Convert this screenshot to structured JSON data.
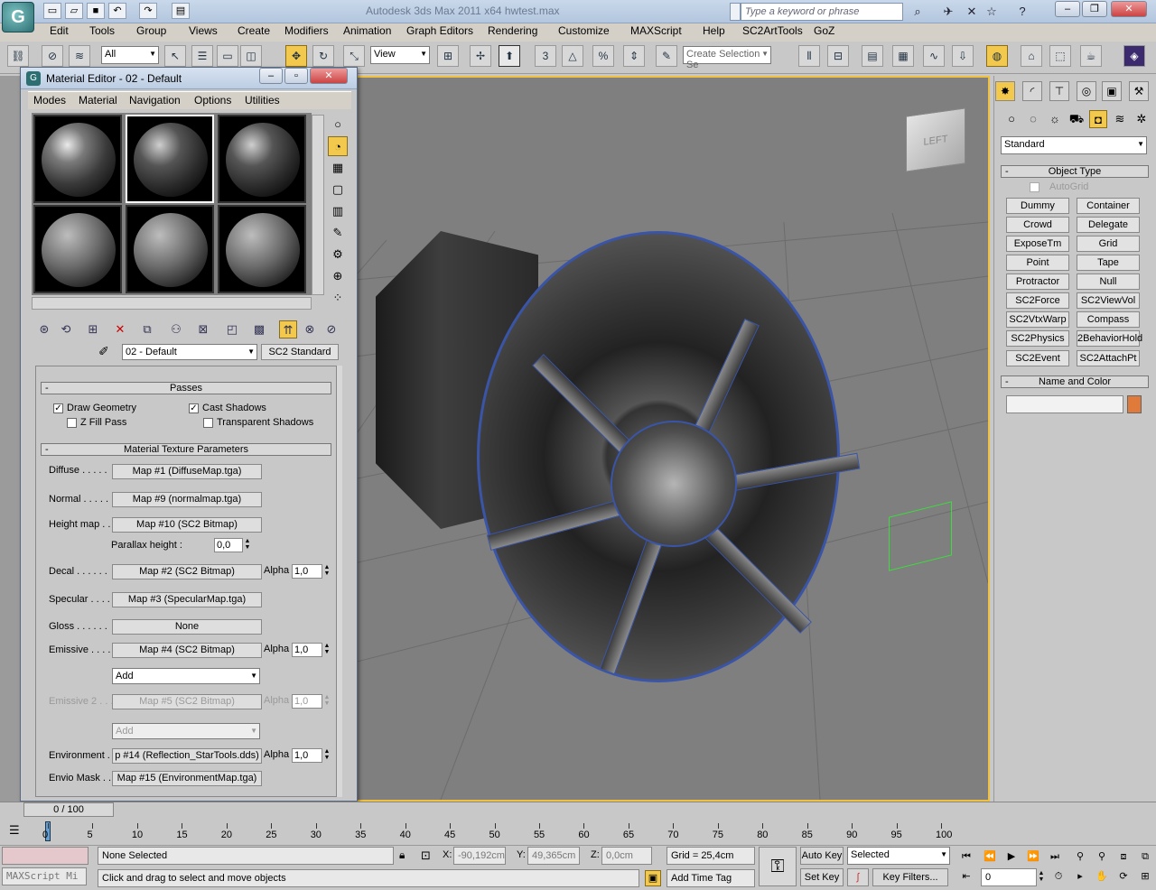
{
  "app": {
    "logo_label": "G",
    "title": "Autodesk 3ds Max  2011 x64      hwtest.max",
    "search_placeholder": "Type a keyword or phrase",
    "window_buttons": [
      "–",
      "❐",
      "✕"
    ]
  },
  "menubar": [
    "Edit",
    "Tools",
    "Group",
    "Views",
    "Create",
    "Modifiers",
    "Animation",
    "Graph Editors",
    "Rendering",
    "Customize",
    "MAXScript",
    "Help",
    "SC2ArtTools",
    "GoZ"
  ],
  "toolbar": {
    "selection_filter": "All",
    "ref_coord": "View",
    "selection_set_placeholder": "Create Selection Se",
    "snap_label": "3",
    "angle_snap_label": "△",
    "percent_snap_label": "%"
  },
  "material_editor": {
    "title": "Material Editor - 02 - Default",
    "menu": [
      "Modes",
      "Material",
      "Navigation",
      "Options",
      "Utilities"
    ],
    "material_name": "02 - Default",
    "material_type": "SC2 Standard",
    "passes": {
      "header": "Passes",
      "draw_geometry": "Draw Geometry",
      "cast_shadows": "Cast Shadows",
      "z_fill_pass": "Z Fill Pass",
      "transparent_shadows": "Transparent Shadows"
    },
    "params_header": "Material Texture Parameters",
    "maps": [
      {
        "label": "Diffuse . . . . .",
        "map": "Map #1 (DiffuseMap.tga)"
      },
      {
        "label": "Normal . . . . .",
        "map": "Map #9 (normalmap.tga)"
      },
      {
        "label": "Height map . .",
        "map": "Map #10 (SC2 Bitmap)"
      },
      {
        "label": "Decal . . . . . .",
        "map": "Map #2 (SC2 Bitmap)",
        "alpha": "1,0"
      },
      {
        "label": "Specular . . . .",
        "map": "Map #3 (SpecularMap.tga)"
      },
      {
        "label": "Gloss . . . . . .",
        "map": "None"
      },
      {
        "label": "Emissive . . . .",
        "map": "Map #4 (SC2 Bitmap)",
        "alpha": "1,0"
      },
      {
        "label": "Emissive 2 . . .",
        "map": "Map #5 (SC2 Bitmap)",
        "alpha": "1,0"
      },
      {
        "label": "Environment . .",
        "map": "p #14 (Reflection_StarTools.dds)",
        "alpha": "1,0"
      },
      {
        "label": "Envio Mask . .",
        "map": "Map #15 (EnvironmentMap.tga)"
      }
    ],
    "parallax_label": "Parallax height :",
    "parallax_value": "0,0",
    "alpha_label": "Alpha",
    "add_label": "Add"
  },
  "command_panel": {
    "category": "Standard",
    "object_type_header": "Object Type",
    "autogrid": "AutoGrid",
    "buttons": [
      "Dummy",
      "Container",
      "Crowd",
      "Delegate",
      "ExposeTm",
      "Grid",
      "Point",
      "Tape",
      "Protractor",
      "Null",
      "SC2Force",
      "SC2ViewVol",
      "SC2VtxWarp",
      "Compass",
      "SC2Physics",
      "2BehaviorHold",
      "SC2Event",
      "SC2AttachPt"
    ],
    "name_color_header": "Name and Color",
    "name_value": "",
    "color": "#e07a3a"
  },
  "viewport": {
    "viewcube_label": "LEFT"
  },
  "timeline": {
    "slider": "0 / 100",
    "ticks": [
      "0",
      "5",
      "10",
      "15",
      "20",
      "25",
      "30",
      "35",
      "40",
      "45",
      "50",
      "55",
      "60",
      "65",
      "70",
      "75",
      "80",
      "85",
      "90",
      "95",
      "100"
    ]
  },
  "status": {
    "maxscript_placeholder": "MAXScript Mi",
    "selection": "None Selected",
    "prompt": "Click and drag to select and move objects",
    "x_label": "X:",
    "x_value": "-90,192cm",
    "y_label": "Y:",
    "y_value": "49,365cm",
    "z_label": "Z:",
    "z_value": "0,0cm",
    "grid": "Grid = 25,4cm",
    "add_time_tag": "Add Time Tag",
    "auto_key": "Auto Key",
    "set_key": "Set Key",
    "key_mode": "Selected",
    "key_filters": "Key Filters...",
    "frame": "0"
  }
}
